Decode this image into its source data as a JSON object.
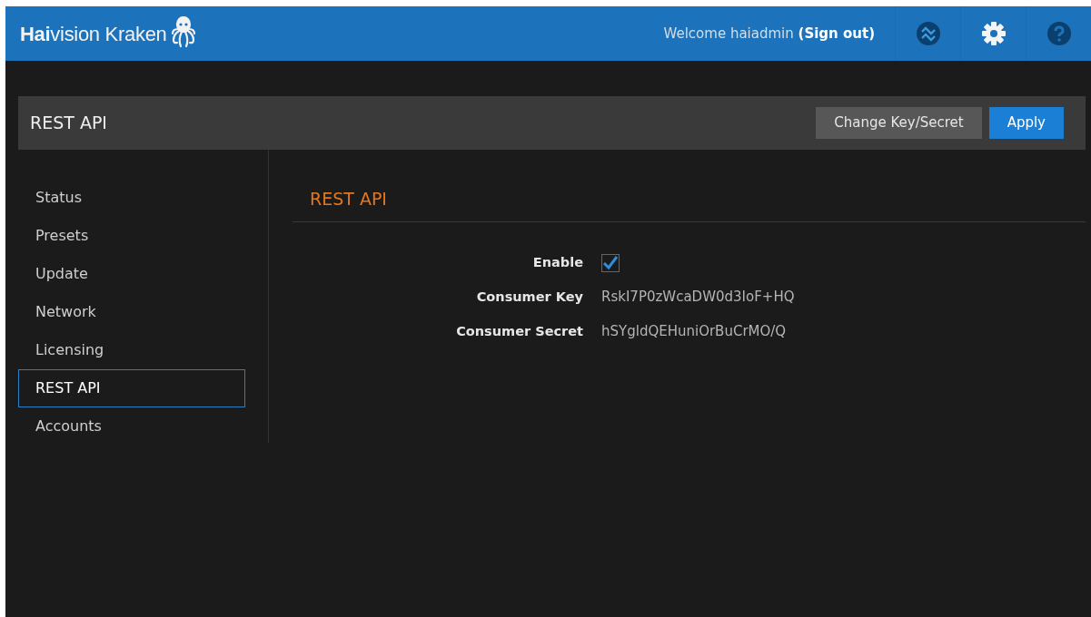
{
  "header": {
    "brand": "**Hai**vision Kraken",
    "welcome": "Welcome haiadmin",
    "sign_out": "(Sign out)",
    "icons": [
      {
        "kind": "status"
      },
      {
        "kind": "settings"
      },
      {
        "kind": "help"
      }
    ]
  },
  "toolbar": {
    "title": "REST API",
    "buttons": [
      {
        "label": "Change Key/Secret",
        "kind": "secondary"
      },
      {
        "label": "Apply",
        "kind": "primary"
      }
    ]
  },
  "sidebar": {
    "items": [
      {
        "label": "Status",
        "selected": false
      },
      {
        "label": "Presets",
        "selected": false
      },
      {
        "label": "Update",
        "selected": false
      },
      {
        "label": "Network",
        "selected": false
      },
      {
        "label": "Licensing",
        "selected": false
      },
      {
        "label": "REST API",
        "selected": true
      },
      {
        "label": "Accounts",
        "selected": false
      }
    ]
  },
  "panel": {
    "title": "REST API",
    "fields": [
      {
        "label": "Enable",
        "kind": "checkbox",
        "checked": true
      },
      {
        "label": "Consumer Key",
        "kind": "text",
        "value": "RskI7P0zWcaDW0d3IoF+HQ"
      },
      {
        "label": "Consumer Secret",
        "kind": "text",
        "value": "hSYgldQEHuniOrBuCrMO/Q"
      }
    ]
  }
}
